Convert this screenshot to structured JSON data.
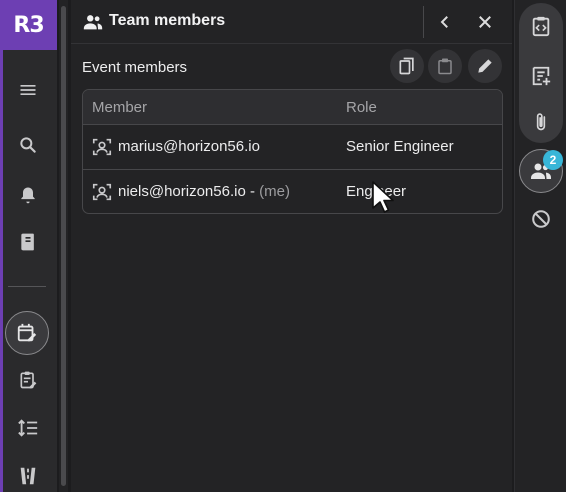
{
  "app": {
    "logo_text": "R3",
    "brand_color": "#6d3fb3"
  },
  "left_nav": {
    "items": [
      {
        "icon": "menu-icon"
      },
      {
        "icon": "search-icon"
      },
      {
        "icon": "bell-icon"
      },
      {
        "icon": "book-icon"
      },
      {
        "icon": "calendar-edit-icon",
        "active": true
      },
      {
        "icon": "clipboard-edit-icon"
      },
      {
        "icon": "sort-list-icon"
      },
      {
        "icon": "road-icon"
      }
    ]
  },
  "panel": {
    "title": "Team members",
    "title_icon": "team-icon",
    "section_title": "Event members",
    "actions": [
      "copy-icon",
      "paste-icon",
      "edit-icon"
    ]
  },
  "table": {
    "columns": [
      "Member",
      "Role"
    ],
    "rows": [
      {
        "member": "marius@horizon56.io",
        "suffix": "",
        "role": "Senior Engineer"
      },
      {
        "member": "niels@horizon56.io - ",
        "suffix": "(me)",
        "role": "Engineer"
      }
    ]
  },
  "right_rail": {
    "items": [
      "clipboard-code-icon",
      "note-add-icon",
      "paperclip-icon",
      "team-icon",
      "block-icon"
    ],
    "badge_count": "2",
    "badge_color": "#38b6d8"
  }
}
